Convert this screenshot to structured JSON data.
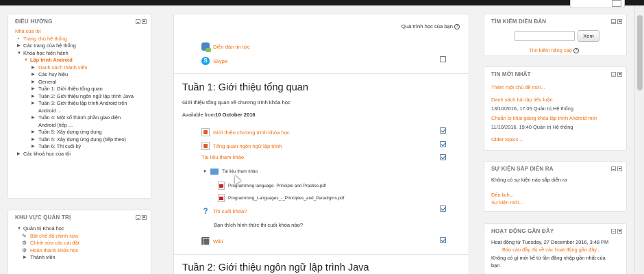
{
  "navigation": {
    "title": "ĐIỀU HƯỚNG",
    "home": "Nhà của tôi",
    "items": [
      "Trang chủ hệ thống",
      "Các trang của hệ thống",
      "Khóa học hiện hành"
    ],
    "course": "Lập trình Android",
    "course_items": [
      "Danh sách thành viên",
      "Các huy hiệu",
      "General",
      "Tuần 1: Giới thiệu tổng quan",
      "Tuần 2: Giới thiệu ngôn ngữ lập trình Java",
      "Tuần 3: Giới thiệu lập trình Android trên",
      "Android ...",
      "Tuần 4: Một số thành phần giao diện",
      "Android (tiếp ...",
      "Tuần 5: Xây dựng ứng dụng",
      "Tuần 5: Xây dựng ứng dụng (tiếp theo)",
      "Tuần 6: Thi cuối kỳ"
    ],
    "my_courses": "Các khoá học của tôi"
  },
  "admin": {
    "title": "KHU VỰC QUẢN TRỊ",
    "course_admin": "Quản trị Khoá học",
    "items": [
      "Bật chế độ chỉnh sửa",
      "Chỉnh sửa các cài đặt",
      "Hoàn thành khóa học",
      "Thành viên"
    ]
  },
  "main": {
    "progress_label": "Quá trình học của bạn",
    "top_activities": [
      {
        "icon": "forum-icon",
        "label": "Diễn đàn tin tức",
        "check": "none"
      },
      {
        "icon": "skype-icon",
        "label": "Skype",
        "check": "empty"
      }
    ],
    "week1": {
      "title": "Tuần 1: Giới thiệu tổng quan",
      "summary": "Giới thiệu tổng quan về chương trình khóa học",
      "available_prefix": "Available from ",
      "available_date": "10 October 2016",
      "activities": [
        {
          "label": "Giới thiệu chương trình khóa học"
        },
        {
          "label": "Tổng quan ngôn ngữ lập trình"
        },
        {
          "label": "Tài liệu tham khảo"
        }
      ],
      "folder_name": "Tài liệu tham khảo",
      "files": [
        "Programming language- Principle and Practice.pdf",
        "Programming_Languages_-_Principles_and_Paradigms.pdf"
      ],
      "quiz": "Thi cuối khóa?",
      "quiz_question": "Bạn thích hình thức thi cuối khóa nào?",
      "wiki": "Wiki"
    },
    "week2": {
      "title": "Tuần 2: Giới thiệu ngôn ngữ lập trình Java"
    }
  },
  "search": {
    "title": "TÌM KIẾM DIỄN ĐÀN",
    "input_value": "",
    "button": "Xem",
    "advanced": "Tìm kiếm nâng cao"
  },
  "news": {
    "title": "TIN MỚI NHẤT",
    "add_topic": "Thêm một chủ đề mới...",
    "posts": [
      {
        "title": "Danh sách bài tập tiểu luận",
        "meta": "13/10/2016, 17:05 Quản trị Hệ thống"
      },
      {
        "title": "Chuẩn bị khai giảng khóa lập trình Android mới",
        "meta": "11/10/2016, 19:40 Quản trị Hệ thống"
      }
    ],
    "older": "Older topics ..."
  },
  "events": {
    "title": "SỰ KIỆN SẮP DIỄN RA",
    "none": "Không có sự kiện nào sắp diễn ra",
    "go_to": "Đến lịch...",
    "new_event": "Sự kiện mới..."
  },
  "activity": {
    "title": "HOẠT ĐỘNG GẦN ĐÂY",
    "since": "Hoạt động từ Tuesday, 27 December 2016, 3:48 PM",
    "report_link": "Báo cáo đầy đủ về các hoạt động gần đây...",
    "none_line1": "Không có gì mới kể từ lần đăng nhập gần nhất của",
    "none_line2": "bạn"
  }
}
